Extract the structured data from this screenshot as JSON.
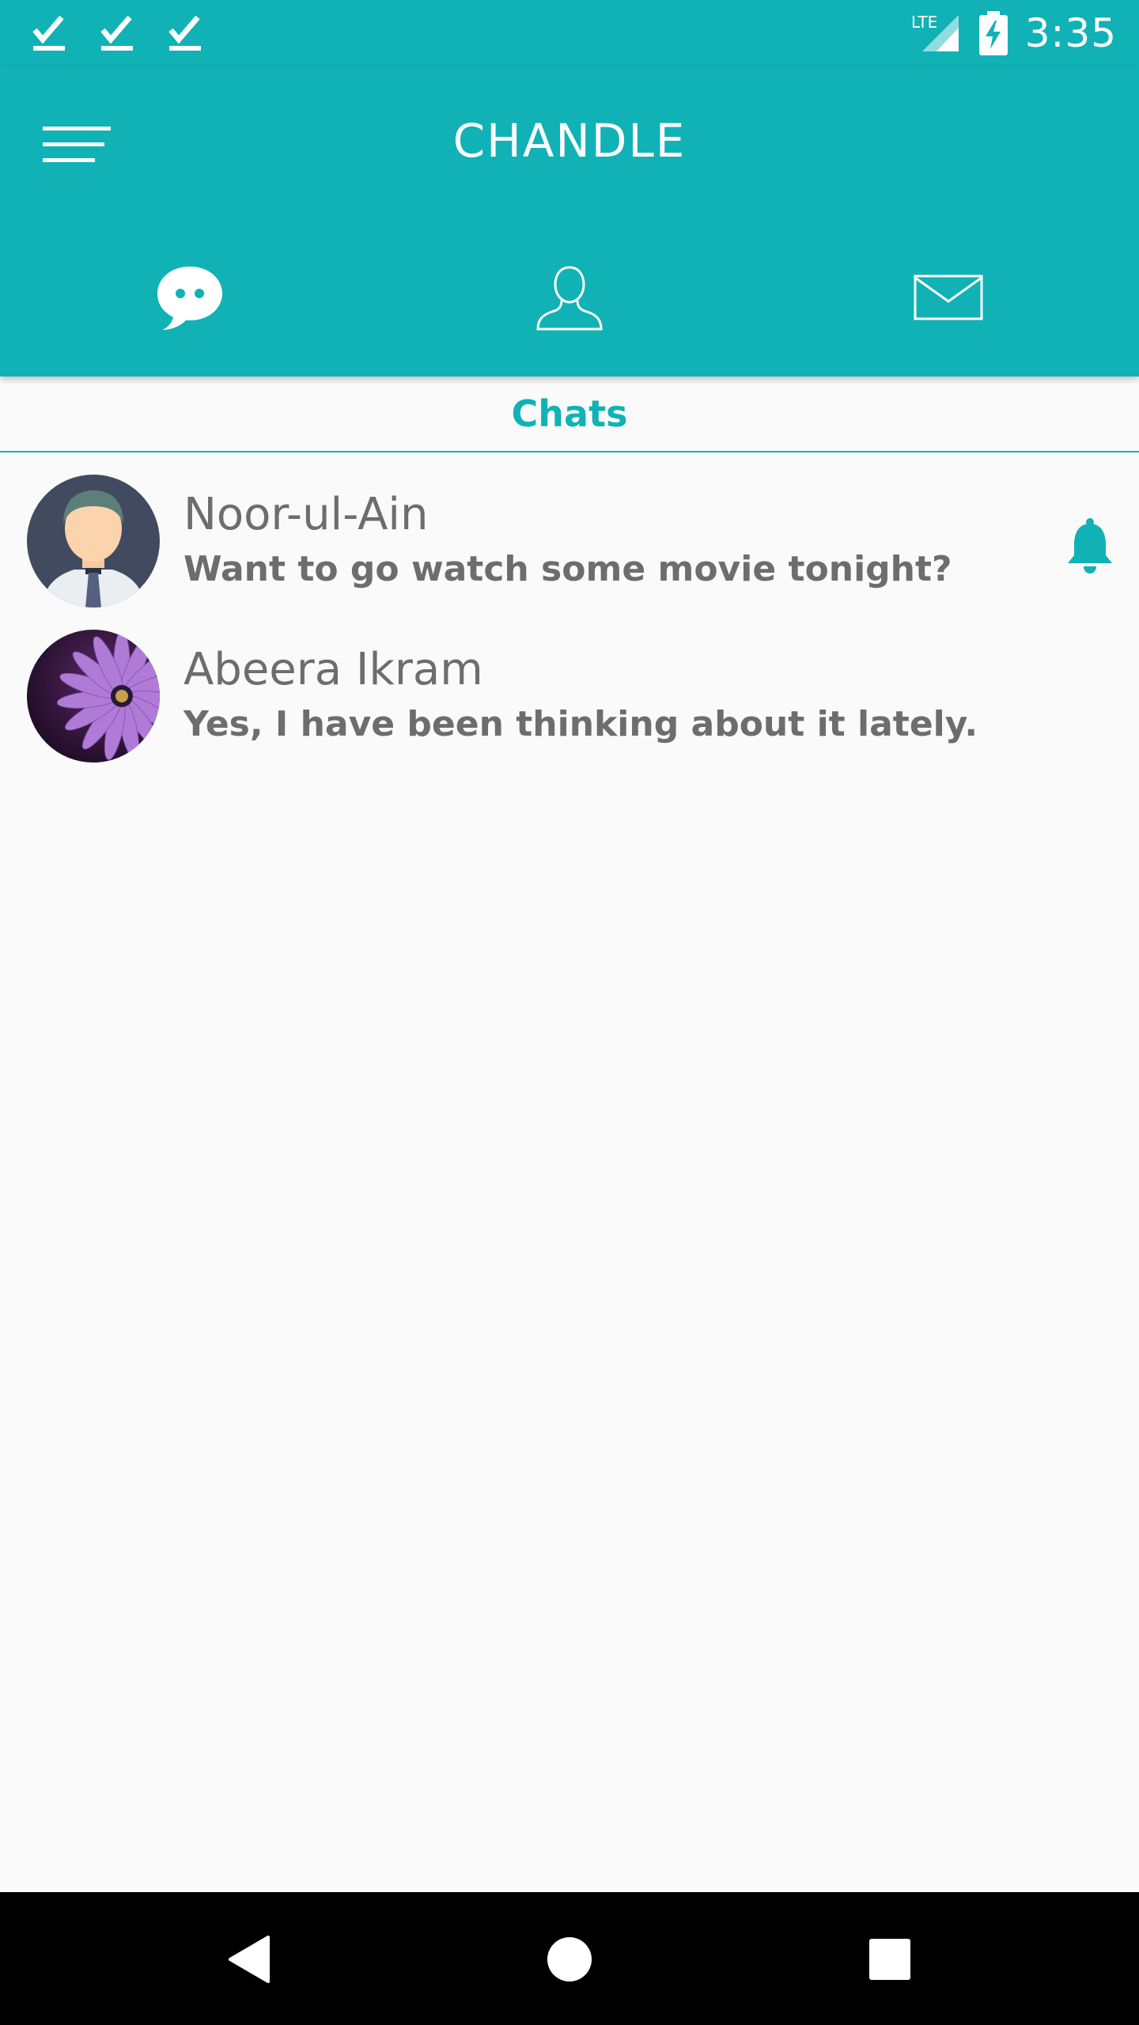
{
  "status_bar": {
    "time": "3:35",
    "network_label": "LTE",
    "left_icons": [
      "check-icon",
      "check-icon",
      "check-icon"
    ]
  },
  "app_bar": {
    "title": "CHANDLE",
    "menu_icon": "menu-icon",
    "tabs": [
      {
        "name": "chats",
        "icon": "chat-bubble-icon",
        "active": true
      },
      {
        "name": "contacts",
        "icon": "person-icon",
        "active": false
      },
      {
        "name": "messages",
        "icon": "mail-icon",
        "active": false
      }
    ]
  },
  "section": {
    "title": "Chats"
  },
  "chats": [
    {
      "name": "Noor-ul-Ain",
      "preview": "Want to go watch some movie tonight?",
      "avatar": "man-avatar",
      "notification": true
    },
    {
      "name": "Abeera Ikram",
      "preview": "Yes, I have been thinking about it lately.",
      "avatar": "purple-flower-avatar",
      "notification": false
    }
  ],
  "colors": {
    "primary": "#10b2b6",
    "background": "#fafafa",
    "text": "#6d6d6d"
  },
  "nav_bar": {
    "icons": [
      "back-icon",
      "home-icon",
      "recent-apps-icon"
    ]
  }
}
